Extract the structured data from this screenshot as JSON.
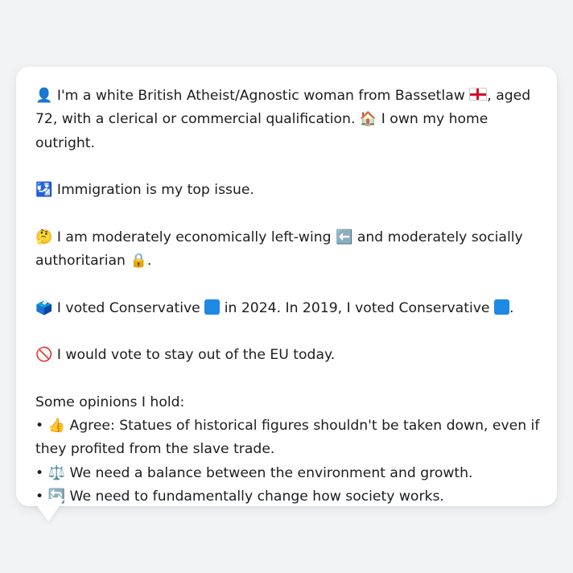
{
  "profile": {
    "line1_icon": "👤",
    "line1_a": "I'm a white British Atheist/Agnostic woman from Bassetlaw",
    "line1_b": ", aged 72, with a clerical or commercial qualification.",
    "home_icon": "🏠",
    "line1_c": "I own my home outright.",
    "flag_icon": "england-flag",
    "issue_icon": "🛂",
    "issue_text": "Immigration is my top issue.",
    "ideology_icon": "🤔",
    "ideology_a": "I am moderately economically left-wing",
    "left_icon": "⬅️",
    "ideology_b": "and moderately socially authoritarian",
    "lock_icon": "🔒",
    "ideology_end": ".",
    "vote_icon": "🗳️",
    "vote_a": "I voted Conservative",
    "vote_b": "in 2024. In 2019, I voted Conservative",
    "vote_end": ".",
    "party_color": "#1e88e5",
    "eu_icon": "🚫",
    "eu_text": "I would vote to stay out of the EU today.",
    "opinions_heading": "Some opinions I hold:",
    "opinions": [
      {
        "icon": "👍",
        "text": "Agree: Statues of historical figures shouldn't be taken down, even if they profited from the slave trade."
      },
      {
        "icon": "⚖️",
        "text": "We need a balance between the environment and growth."
      },
      {
        "icon": "🔄",
        "text": "We need to fundamentally change how society works."
      }
    ]
  }
}
